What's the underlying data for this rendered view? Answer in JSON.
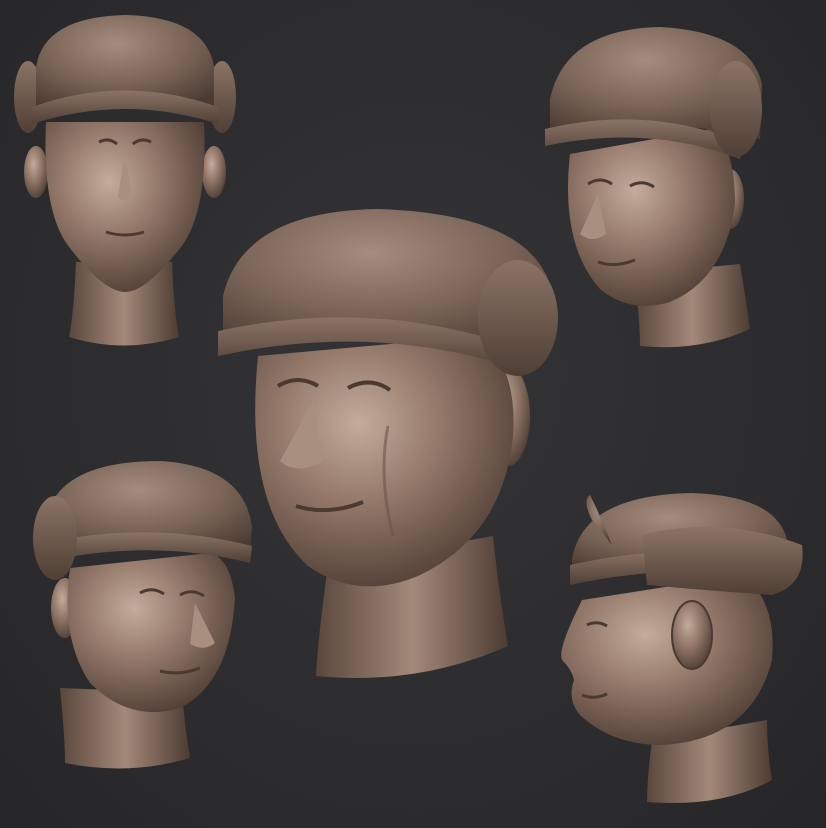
{
  "canvas": {
    "background": "#2d2d2f"
  },
  "material": {
    "skin_base": "#8a7263",
    "skin_light": "#c2a898",
    "skin_dark": "#4a3a32",
    "cap_base": "#7b6558",
    "fur_base": "#6a564b"
  },
  "views": [
    {
      "name": "front",
      "description_icon": "head-sculpt-front-icon"
    },
    {
      "name": "three-quarter-right",
      "description_icon": "head-sculpt-three-quarter-icon"
    },
    {
      "name": "hero-three-quarter",
      "description_icon": "head-sculpt-hero-icon"
    },
    {
      "name": "three-quarter-left",
      "description_icon": "head-sculpt-three-quarter-left-icon"
    },
    {
      "name": "profile",
      "description_icon": "head-sculpt-profile-icon"
    }
  ]
}
